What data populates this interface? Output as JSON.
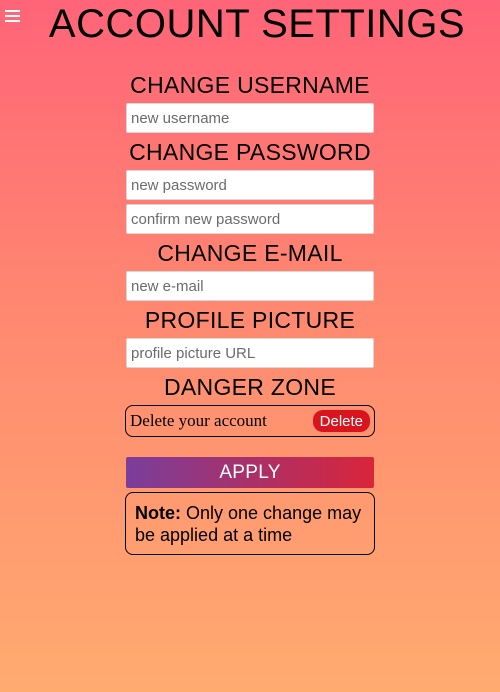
{
  "header": {
    "menu_icon": "hamburger-menu-icon",
    "title": "ACCOUNT SETTINGS"
  },
  "username": {
    "title": "CHANGE USERNAME",
    "placeholder": "new username",
    "value": ""
  },
  "password": {
    "title": "CHANGE PASSWORD",
    "new_placeholder": "new password",
    "confirm_placeholder": "confirm new password"
  },
  "email": {
    "title": "CHANGE E-MAIL",
    "placeholder": "new e-mail"
  },
  "picture": {
    "title": "PROFILE PICTURE",
    "placeholder": "profile picture URL"
  },
  "danger": {
    "title": "DANGER ZONE",
    "text": "Delete your account",
    "delete_label": "Delete",
    "delete_color": "#d8151e"
  },
  "apply": {
    "label": "APPLY"
  },
  "note": {
    "label": "Note:",
    "text": "Only one change may be applied at a time"
  },
  "colors": {
    "background_top": "#ff6478",
    "background_bottom": "#ffab70"
  }
}
